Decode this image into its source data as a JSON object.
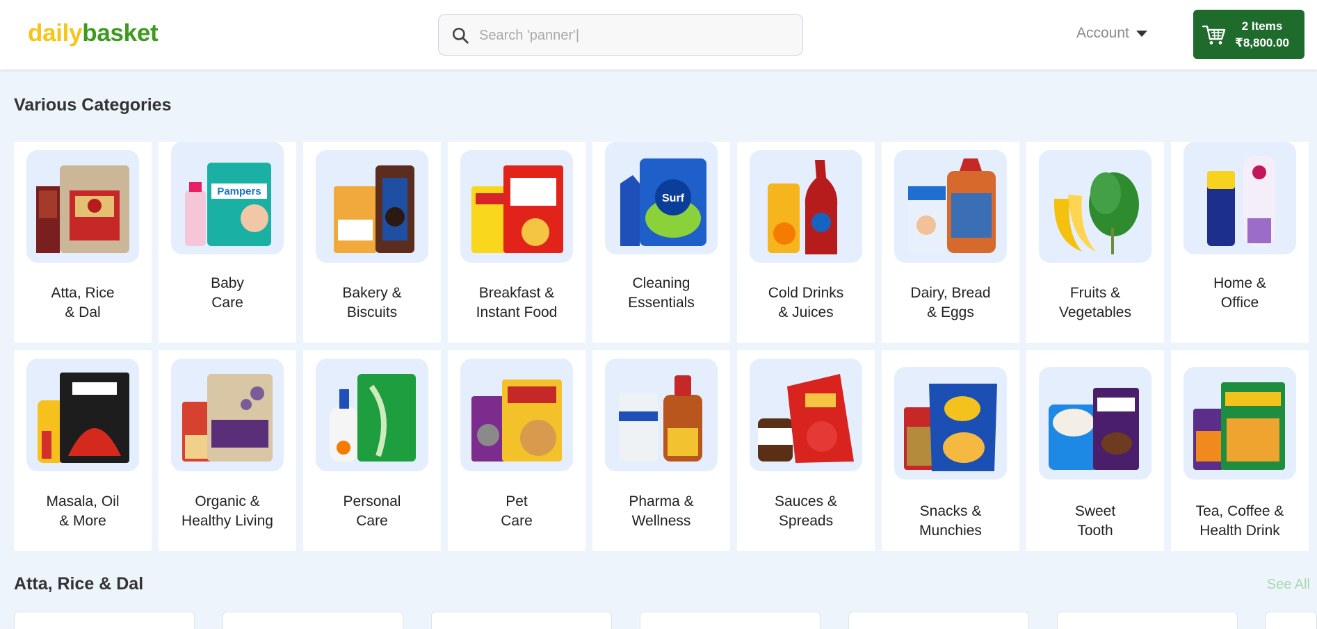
{
  "header": {
    "logo_part1": "daily",
    "logo_part2": "basket",
    "search_placeholder": "Search 'panner'|",
    "account_label": "Account",
    "cart_items": "2 Items",
    "cart_total": "₹8,800.00"
  },
  "categories_title": "Various Categories",
  "categories": [
    {
      "line1": "Atta, Rice",
      "line2": "& Dal",
      "icon": "atta-rice-dal-icon"
    },
    {
      "line1": "Baby",
      "line2": "Care",
      "icon": "baby-care-icon"
    },
    {
      "line1": "Bakery &",
      "line2": "Biscuits",
      "icon": "bakery-biscuits-icon"
    },
    {
      "line1": "Breakfast &",
      "line2": "Instant Food",
      "icon": "breakfast-instant-food-icon"
    },
    {
      "line1": "Cleaning",
      "line2": "Essentials",
      "icon": "cleaning-essentials-icon"
    },
    {
      "line1": "Cold Drinks",
      "line2": "& Juices",
      "icon": "cold-drinks-juices-icon"
    },
    {
      "line1": "Dairy, Bread",
      "line2": "& Eggs",
      "icon": "dairy-bread-eggs-icon"
    },
    {
      "line1": "Fruits &",
      "line2": "Vegetables",
      "icon": "fruits-vegetables-icon"
    },
    {
      "line1": "Home &",
      "line2": "Office",
      "icon": "home-office-icon"
    },
    {
      "line1": "Masala, Oil",
      "line2": "& More",
      "icon": "masala-oil-icon"
    },
    {
      "line1": "Organic &",
      "line2": "Healthy Living",
      "icon": "organic-healthy-icon"
    },
    {
      "line1": "Personal",
      "line2": "Care",
      "icon": "personal-care-icon"
    },
    {
      "line1": "Pet",
      "line2": "Care",
      "icon": "pet-care-icon"
    },
    {
      "line1": "Pharma &",
      "line2": "Wellness",
      "icon": "pharma-wellness-icon"
    },
    {
      "line1": "Sauces &",
      "line2": "Spreads",
      "icon": "sauces-spreads-icon"
    },
    {
      "line1": "Snacks &",
      "line2": "Munchies",
      "icon": "snacks-munchies-icon"
    },
    {
      "line1": "Sweet",
      "line2": "Tooth",
      "icon": "sweet-tooth-icon"
    },
    {
      "line1": "Tea, Coffee &",
      "line2": "Health Drink",
      "icon": "tea-coffee-icon"
    }
  ],
  "section2_title": "Atta, Rice & Dal",
  "see_all_label": "See All",
  "colors": {
    "brand_yellow": "#f5c518",
    "brand_green": "#3d9a1e",
    "cart_green": "#1e6b2c",
    "page_bg": "#eef4fc",
    "thumb_bg": "#e4eefc"
  }
}
